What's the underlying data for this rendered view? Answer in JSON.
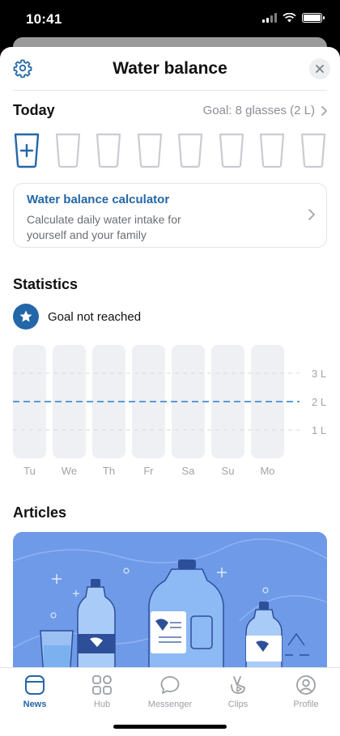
{
  "status_bar": {
    "time": "10:41"
  },
  "header": {
    "title": "Water balance"
  },
  "today": {
    "title": "Today",
    "goal_text": "Goal: 8 glasses (2 L)",
    "glasses_total": 8,
    "glasses_filled": 0
  },
  "calculator": {
    "title": "Water balance calculator",
    "description": "Calculate daily water intake for yourself and your family"
  },
  "statistics": {
    "title": "Statistics",
    "goal_status": "Goal not reached"
  },
  "chart_data": {
    "type": "bar",
    "categories": [
      "Tu",
      "We",
      "Th",
      "Fr",
      "Sa",
      "Su",
      "Mo"
    ],
    "values": [
      0,
      0,
      0,
      0,
      0,
      0,
      0
    ],
    "y_ticks": [
      "3 L",
      "2 L",
      "1 L"
    ],
    "y_tick_values": [
      3,
      2,
      1
    ],
    "goal_line": 2,
    "ylim": [
      0,
      4
    ]
  },
  "articles": {
    "title": "Articles"
  },
  "tabs": [
    {
      "label": "News",
      "icon": "news-icon",
      "active": true
    },
    {
      "label": "Hub",
      "icon": "hub-icon",
      "active": false
    },
    {
      "label": "Messenger",
      "icon": "messenger-icon",
      "active": false
    },
    {
      "label": "Clips",
      "icon": "clips-icon",
      "active": false
    },
    {
      "label": "Profile",
      "icon": "profile-icon",
      "active": false
    }
  ],
  "colors": {
    "accent": "#2367a8",
    "glass_empty": "#c9ccd0",
    "bar": "#eef0f3",
    "goal_line": "#5b9bd6",
    "article_bg": "#6e9ae8"
  }
}
